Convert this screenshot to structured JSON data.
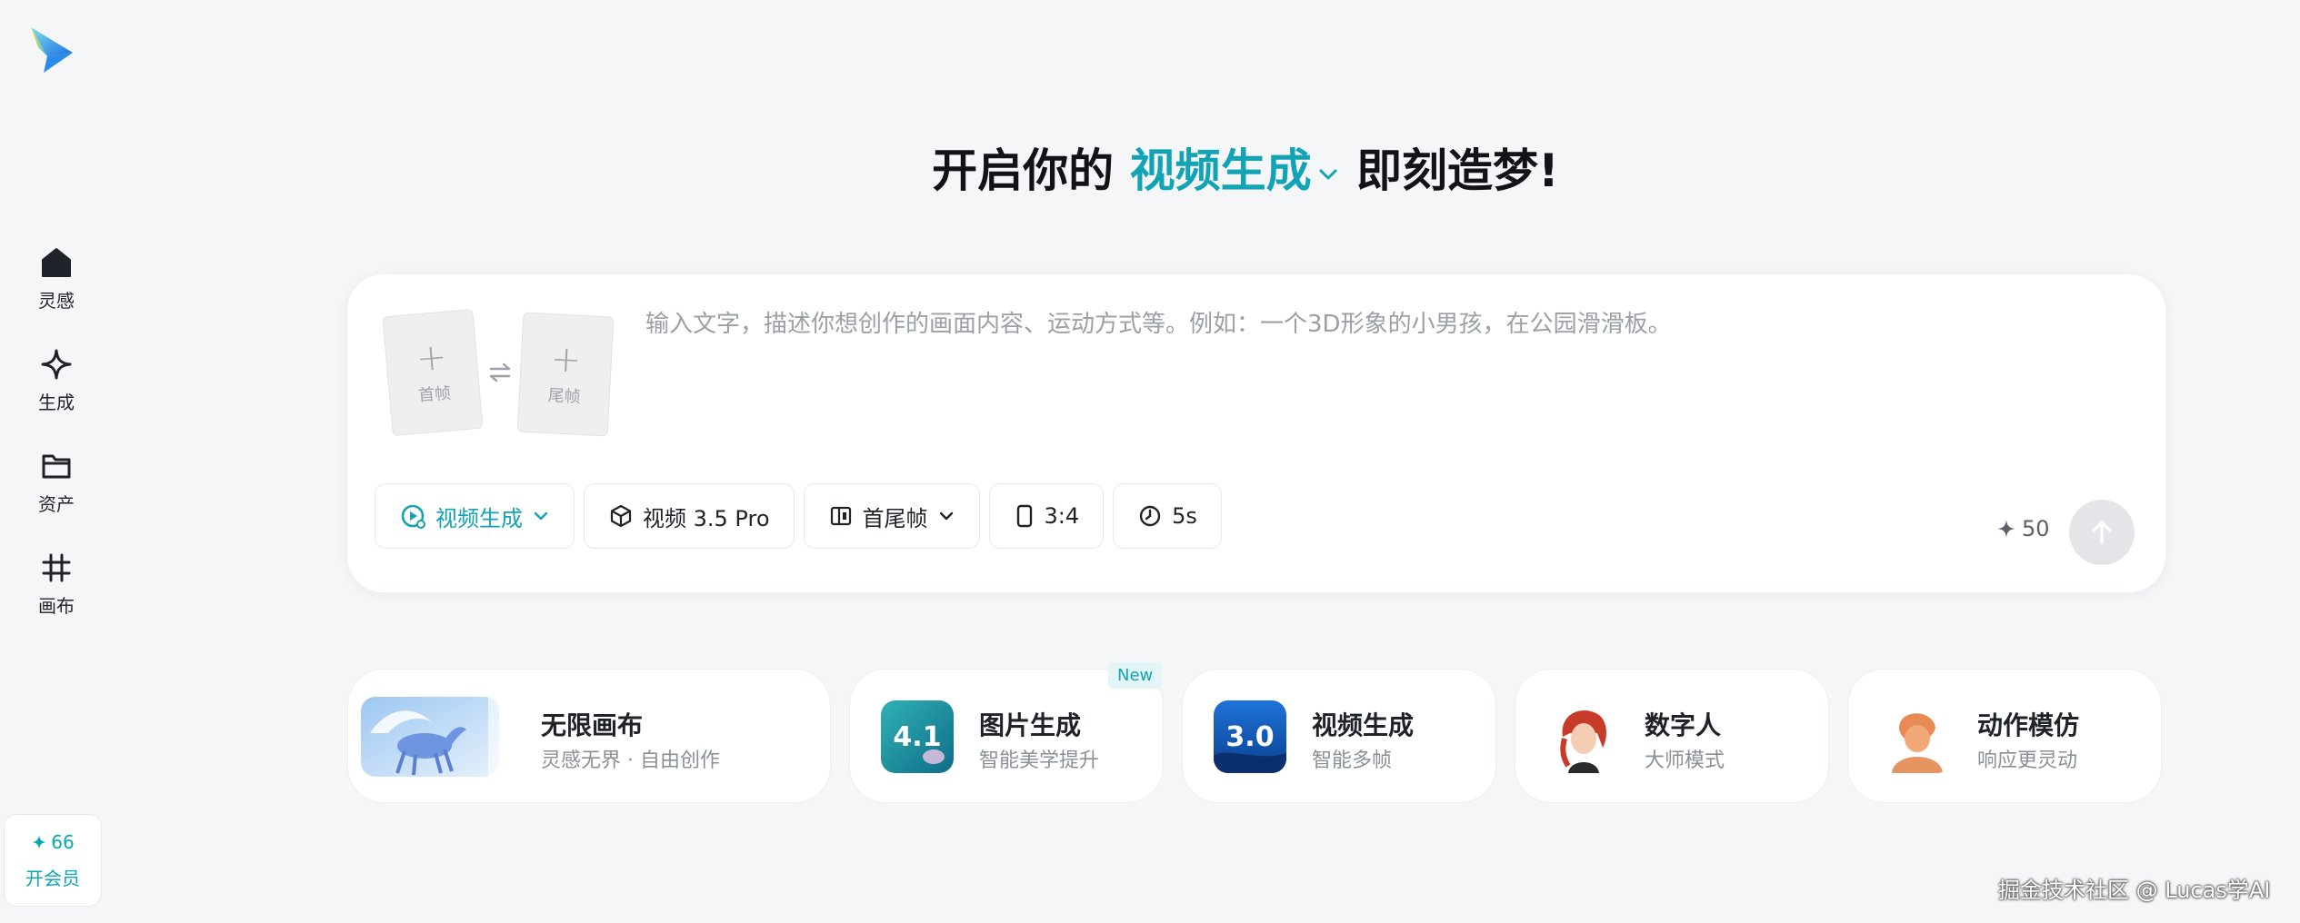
{
  "sidebar": {
    "items": [
      {
        "label": "灵感",
        "icon": "home-icon"
      },
      {
        "label": "生成",
        "icon": "sparkle-icon"
      },
      {
        "label": "资产",
        "icon": "folder-icon"
      },
      {
        "label": "画布",
        "icon": "hash-icon"
      }
    ],
    "member": {
      "points": "66",
      "label": "开会员"
    }
  },
  "headline": {
    "prefix": "开启你的",
    "mode": "视频生成",
    "suffix": "即刻造梦!"
  },
  "prompt": {
    "first_frame_label": "首帧",
    "last_frame_label": "尾帧",
    "placeholder": "输入文字，描述你想创作的画面内容、运动方式等。例如：一个3D形象的小男孩，在公园滑滑板。",
    "value": ""
  },
  "toolbar": {
    "mode": "视频生成",
    "model": "视频 3.5 Pro",
    "frames": "首尾帧",
    "ratio": "3:4",
    "duration": "5s"
  },
  "credits": "50",
  "features": [
    {
      "title": "无限画布",
      "subtitle": "灵感无界 · 自由创作"
    },
    {
      "title": "图片生成",
      "subtitle": "智能美学提升",
      "badge": "New",
      "thumb_text": "4.1"
    },
    {
      "title": "视频生成",
      "subtitle": "智能多帧",
      "thumb_text": "3.0"
    },
    {
      "title": "数字人",
      "subtitle": "大师模式"
    },
    {
      "title": "动作模仿",
      "subtitle": "响应更灵动"
    }
  ],
  "watermark": "掘金技术社区 @ Lucas学AI",
  "colors": {
    "accent": "#12a3b4",
    "background": "#f5f6f8",
    "card": "#ffffff"
  }
}
